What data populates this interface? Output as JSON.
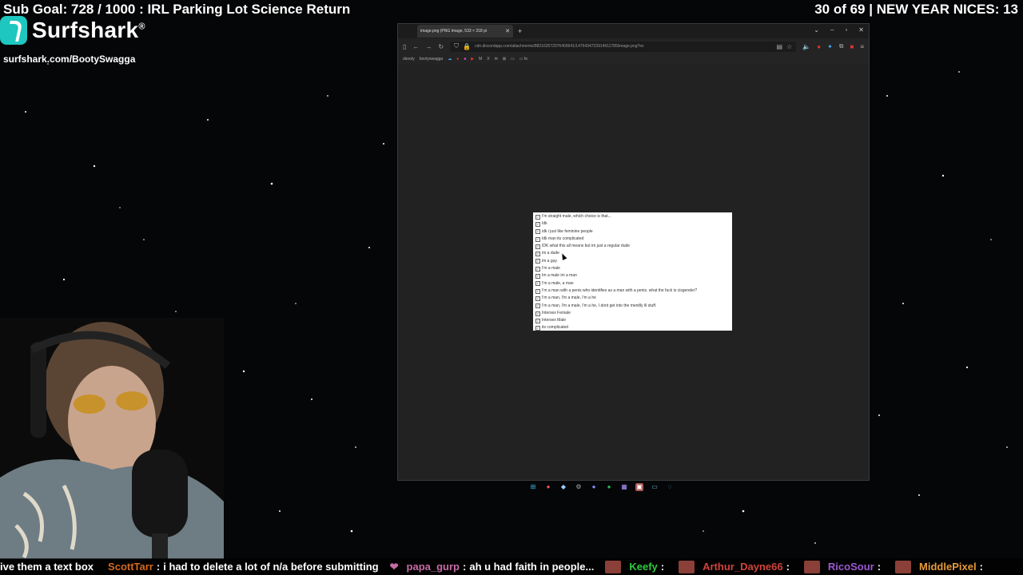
{
  "overlay": {
    "sub_goal": "Sub Goal: 728 / 1000 : IRL Parking Lot Science Return",
    "brand_name": "Surfshark",
    "brand_reg": "®",
    "brand_url": "surfshark.com/BootySwagga",
    "counter": "30 of 69 | NEW YEAR NICES: 13"
  },
  "browser": {
    "tab_title": "image.png (PNG Image, 533 × 318 pi",
    "url": "cdn.discordapp.com/attachments/882162572076400641/1476434723914911785/image.png?ex",
    "bookmarks": [
      "sbooty",
      "bootyswagga"
    ],
    "bookmark_folder": "fo"
  },
  "options": [
    "I'm straight male, which choice is that...",
    "Idk",
    "idk i just like feminine people",
    "Idk man its complicated",
    "IDK what this all means but im just a regular dude",
    "im a dude",
    "im a guy",
    "I'm a male",
    "Im a male im a man",
    "I'm a male, a man",
    "I'm a man with a penis who identifies as a man with a penis. what the fuck is cisgender?",
    "I'm a man, I'm a male, I'm a he",
    "I'm a man, I'm a male, I'm a he, I dont get into the mentlly ill stuff.",
    "Intersex Female",
    "Intersex Male",
    "its complicated"
  ],
  "chat": [
    {
      "user": "",
      "text": "ive them a text box",
      "color": "#ffffff"
    },
    {
      "user": "ScottTarr",
      "text": "i had to delete a lot of n/a before submitting",
      "color": "#d2691e"
    },
    {
      "user": "papa_gurp",
      "text": "ah u had faith in people...",
      "color": "#c86aa5"
    },
    {
      "user": "Keefy",
      "text": "",
      "color": "#2ecc40"
    },
    {
      "user": "Arthur_Dayne66",
      "text": "",
      "color": "#d2433a"
    },
    {
      "user": "RicoSour",
      "text": "",
      "color": "#9b59d0"
    },
    {
      "user": "MiddlePixel",
      "text": "",
      "color": "#e69a3a"
    }
  ],
  "colors": {
    "brand": "#1ec7c0",
    "browser_bg": "#242424",
    "background": "#050608"
  }
}
